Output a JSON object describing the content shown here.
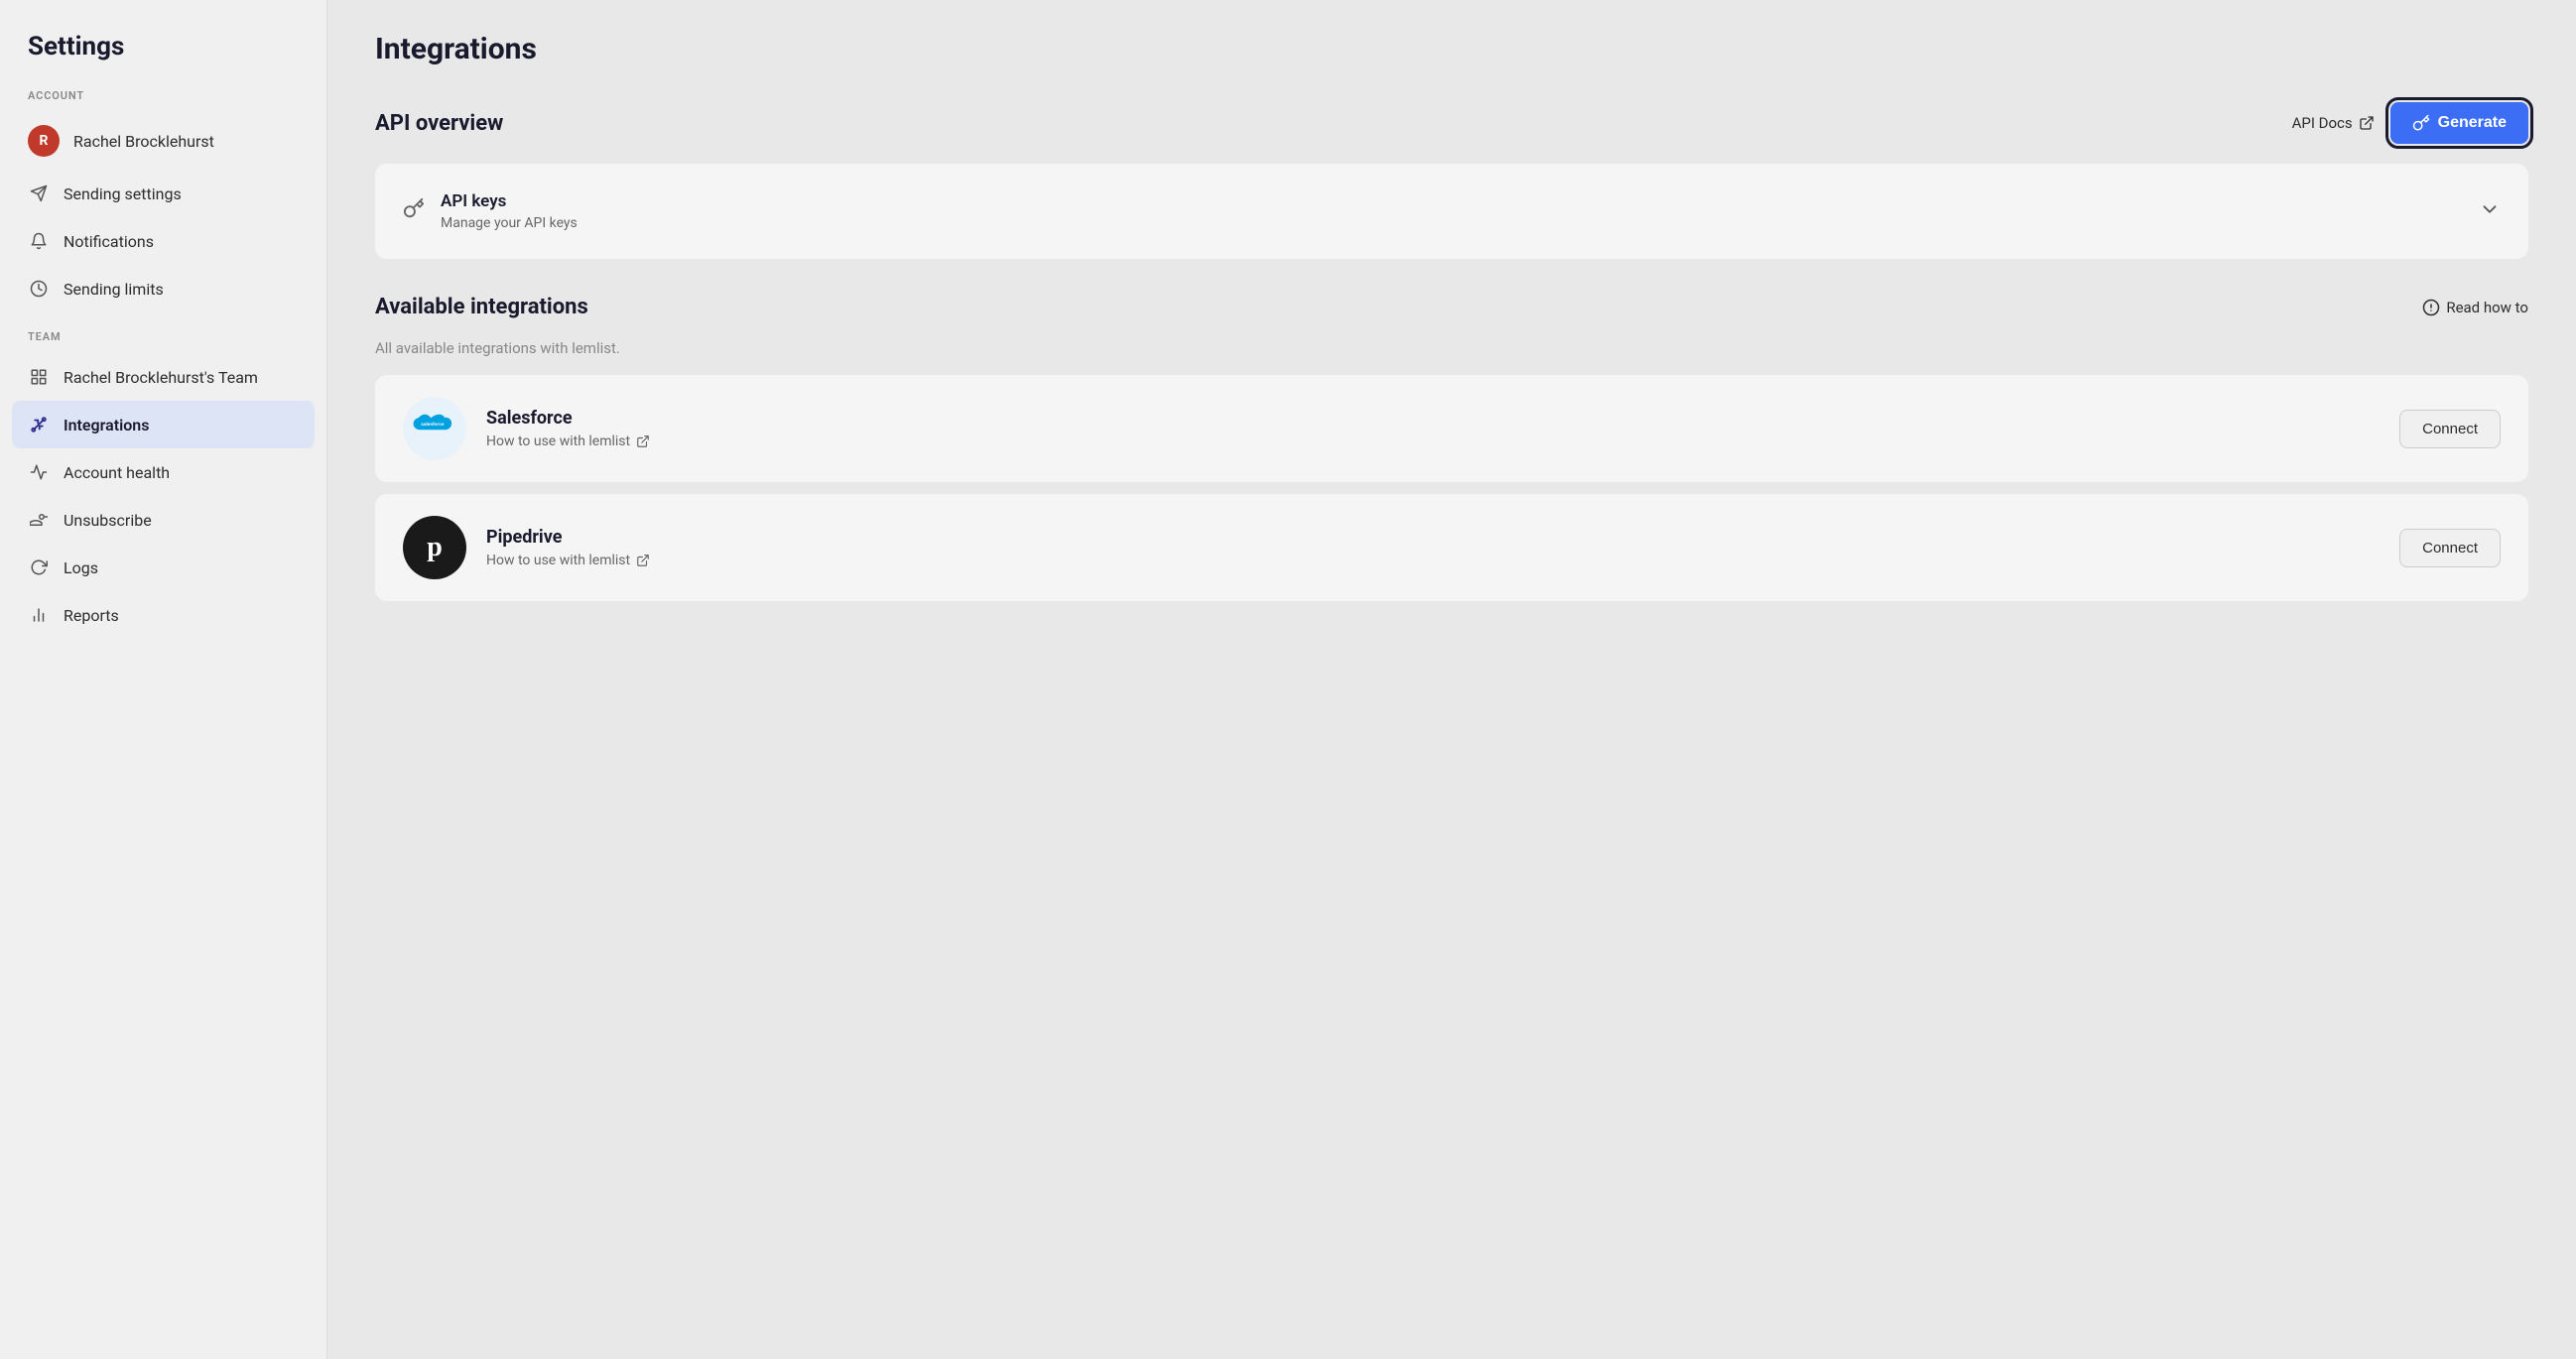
{
  "sidebar": {
    "title": "Settings",
    "account_section": "ACCOUNT",
    "team_section": "TEAM",
    "user": {
      "initials": "R",
      "name": "Rachel Brocklehurst"
    },
    "account_items": [
      {
        "id": "user",
        "label": "Rachel Brocklehurst",
        "icon": "person"
      },
      {
        "id": "sending-settings",
        "label": "Sending settings",
        "icon": "send"
      },
      {
        "id": "notifications",
        "label": "Notifications",
        "icon": "bell"
      },
      {
        "id": "sending-limits",
        "label": "Sending limits",
        "icon": "gauge"
      }
    ],
    "team_items": [
      {
        "id": "team",
        "label": "Rachel Brocklehurst's Team",
        "icon": "grid"
      },
      {
        "id": "integrations",
        "label": "Integrations",
        "icon": "plug",
        "active": true
      },
      {
        "id": "account-health",
        "label": "Account health",
        "icon": "activity"
      },
      {
        "id": "unsubscribe",
        "label": "Unsubscribe",
        "icon": "user-minus"
      },
      {
        "id": "logs",
        "label": "Logs",
        "icon": "clock"
      },
      {
        "id": "reports",
        "label": "Reports",
        "icon": "bar-chart"
      }
    ]
  },
  "main": {
    "page_title": "Integrations",
    "api_overview": {
      "title": "API overview",
      "api_docs_label": "API Docs",
      "generate_label": "Generate",
      "api_keys_title": "API keys",
      "api_keys_sub": "Manage your API keys"
    },
    "available_integrations": {
      "title": "Available integrations",
      "description": "All available integrations with lemlist.",
      "read_how_label": "Read how to",
      "integrations": [
        {
          "id": "salesforce",
          "name": "Salesforce",
          "link_label": "How to use with lemlist",
          "connect_label": "Connect",
          "logo_type": "salesforce"
        },
        {
          "id": "pipedrive",
          "name": "Pipedrive",
          "link_label": "How to use with lemlist",
          "connect_label": "Connect",
          "logo_type": "pipedrive"
        }
      ]
    }
  }
}
